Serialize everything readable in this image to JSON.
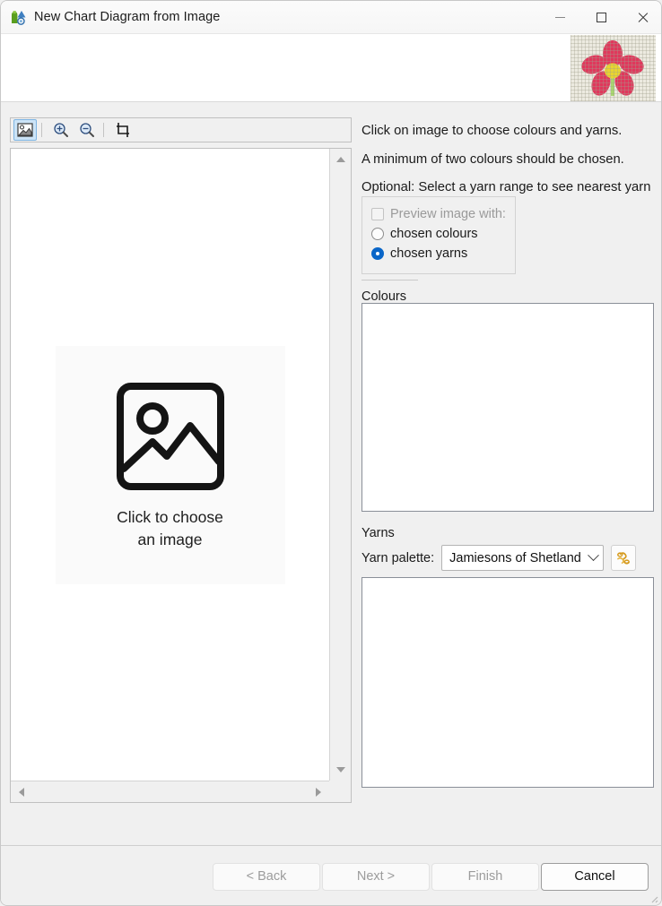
{
  "window": {
    "title": "New Chart Diagram from Image",
    "app_icon": "chart-app-icon",
    "minimize_label": "Minimize",
    "maximize_label": "Maximize",
    "close_label": "Close"
  },
  "banner": {
    "image_name": "flower-chart-thumbnail",
    "petal_color": "#e0385c",
    "center_color": "#e8d430",
    "stem_color": "#a8d66f",
    "grid_color": "#eceae0"
  },
  "left_panel": {
    "toolbar": {
      "tools": [
        {
          "name": "choose-image-tool",
          "icon": "picture-icon",
          "selected": true
        },
        {
          "name": "zoom-in-tool",
          "icon": "zoom-in-icon",
          "selected": false
        },
        {
          "name": "zoom-out-tool",
          "icon": "zoom-out-icon",
          "selected": false
        },
        {
          "name": "crop-tool",
          "icon": "crop-icon",
          "selected": false
        }
      ]
    },
    "placeholder": {
      "icon": "picture-placeholder-icon",
      "label": "Click to choose\nan image"
    },
    "scrollbars": {
      "vertical_up": "scroll-up-arrow",
      "vertical_down": "scroll-down-arrow",
      "horizontal_left": "scroll-left-arrow",
      "horizontal_right": "scroll-right-arrow"
    }
  },
  "right_panel": {
    "instructions": [
      "Click on image to choose colours and yarns.",
      "A minimum of two colours should be chosen.",
      "Optional: Select a yarn range to see nearest yarn"
    ],
    "preview_group": {
      "checkbox_label": "Preview image with:",
      "checkbox_checked": false,
      "checkbox_disabled": true,
      "options": [
        {
          "label": "chosen colours",
          "selected": false
        },
        {
          "label": "chosen yarns",
          "selected": true
        }
      ],
      "accent_color": "#0a66c8"
    },
    "colours_label": "Colours",
    "colours_items": [],
    "yarns_label": "Yarns",
    "yarn_palette_label": "Yarn palette:",
    "yarn_palette_value": "Jamiesons of Shetland",
    "yarn_manage_icon": "yarn-skein-icon",
    "yarns_items": []
  },
  "footer": {
    "buttons": [
      {
        "label": "< Back",
        "name": "back-button",
        "enabled": false
      },
      {
        "label": "Next >",
        "name": "next-button",
        "enabled": false
      },
      {
        "label": "Finish",
        "name": "finish-button",
        "enabled": false
      },
      {
        "label": "Cancel",
        "name": "cancel-button",
        "enabled": true
      }
    ]
  }
}
